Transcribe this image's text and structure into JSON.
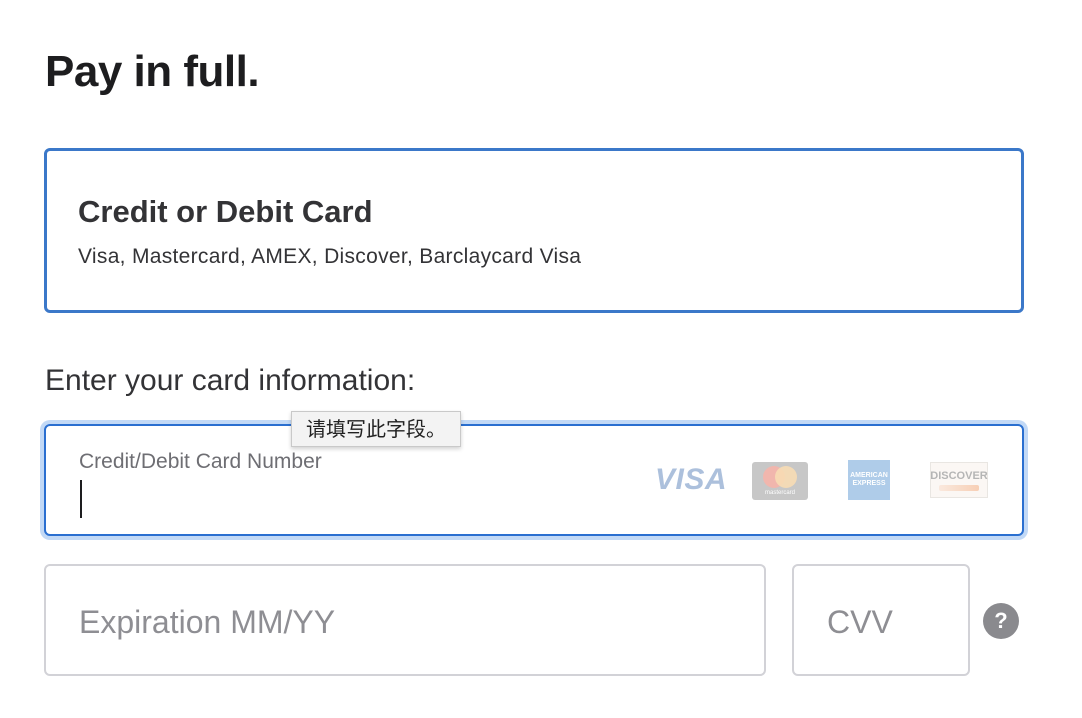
{
  "page": {
    "title": "Pay in full."
  },
  "payment_method": {
    "title": "Credit or Debit Card",
    "subtitle": "Visa, Mastercard, AMEX, Discover, Barclaycard Visa",
    "selected_border_color": "#3b78c9"
  },
  "card_info": {
    "section_label": "Enter your card information:",
    "card_number": {
      "label": "Credit/Debit Card Number",
      "value": "",
      "focused": true
    },
    "validation_tooltip": "请填写此字段。",
    "brands": [
      {
        "name": "VISA",
        "icon": "visa-logo-icon"
      },
      {
        "name": "mastercard",
        "icon": "mastercard-logo-icon"
      },
      {
        "name": "AMERICAN EXPRESS",
        "icon": "amex-logo-icon"
      },
      {
        "name": "DISCOVER",
        "icon": "discover-logo-icon"
      }
    ],
    "expiration": {
      "placeholder": "Expiration MM/YY",
      "value": ""
    },
    "cvv": {
      "placeholder": "CVV",
      "value": ""
    },
    "help_icon_glyph": "?"
  },
  "colors": {
    "focus_border": "#2a6fd0",
    "field_border": "#d2d2d7",
    "placeholder": "#8e8e93"
  }
}
